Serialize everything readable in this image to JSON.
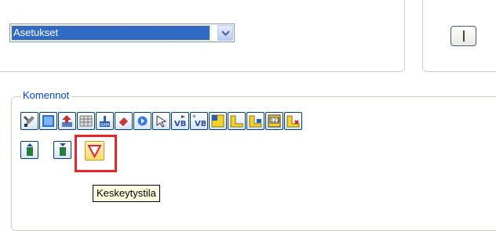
{
  "settings_group": {
    "select_value": "Asetukset"
  },
  "commands_group": {
    "label": "Komennot",
    "row1": [
      {
        "name": "tools-icon"
      },
      {
        "name": "blue-panel-icon"
      },
      {
        "name": "arrow-up-icon"
      },
      {
        "name": "grid-icon"
      },
      {
        "name": "ram-icon"
      },
      {
        "name": "eraser-icon"
      },
      {
        "name": "step-icon"
      },
      {
        "name": "pointer-icon"
      },
      {
        "name": "vb-arrow-icon"
      },
      {
        "name": "vb-star-icon"
      },
      {
        "name": "yellow-window-icon"
      },
      {
        "name": "yellow-folder-icon"
      },
      {
        "name": "yellow-folder-blue-icon"
      },
      {
        "name": "counter-123-icon"
      },
      {
        "name": "yellow-folder-red-icon"
      }
    ],
    "row2": [
      {
        "name": "bottle-up-icon"
      },
      {
        "name": "bottle-down-icon"
      },
      {
        "name": "breakpoint-triangle-icon"
      }
    ]
  },
  "tooltip": {
    "text": "Keskeytystila"
  },
  "colors": {
    "accent": "#316ac5",
    "group_label": "#0046d5",
    "highlight": "#e8232c",
    "tooltip_bg": "#ffffe1"
  }
}
